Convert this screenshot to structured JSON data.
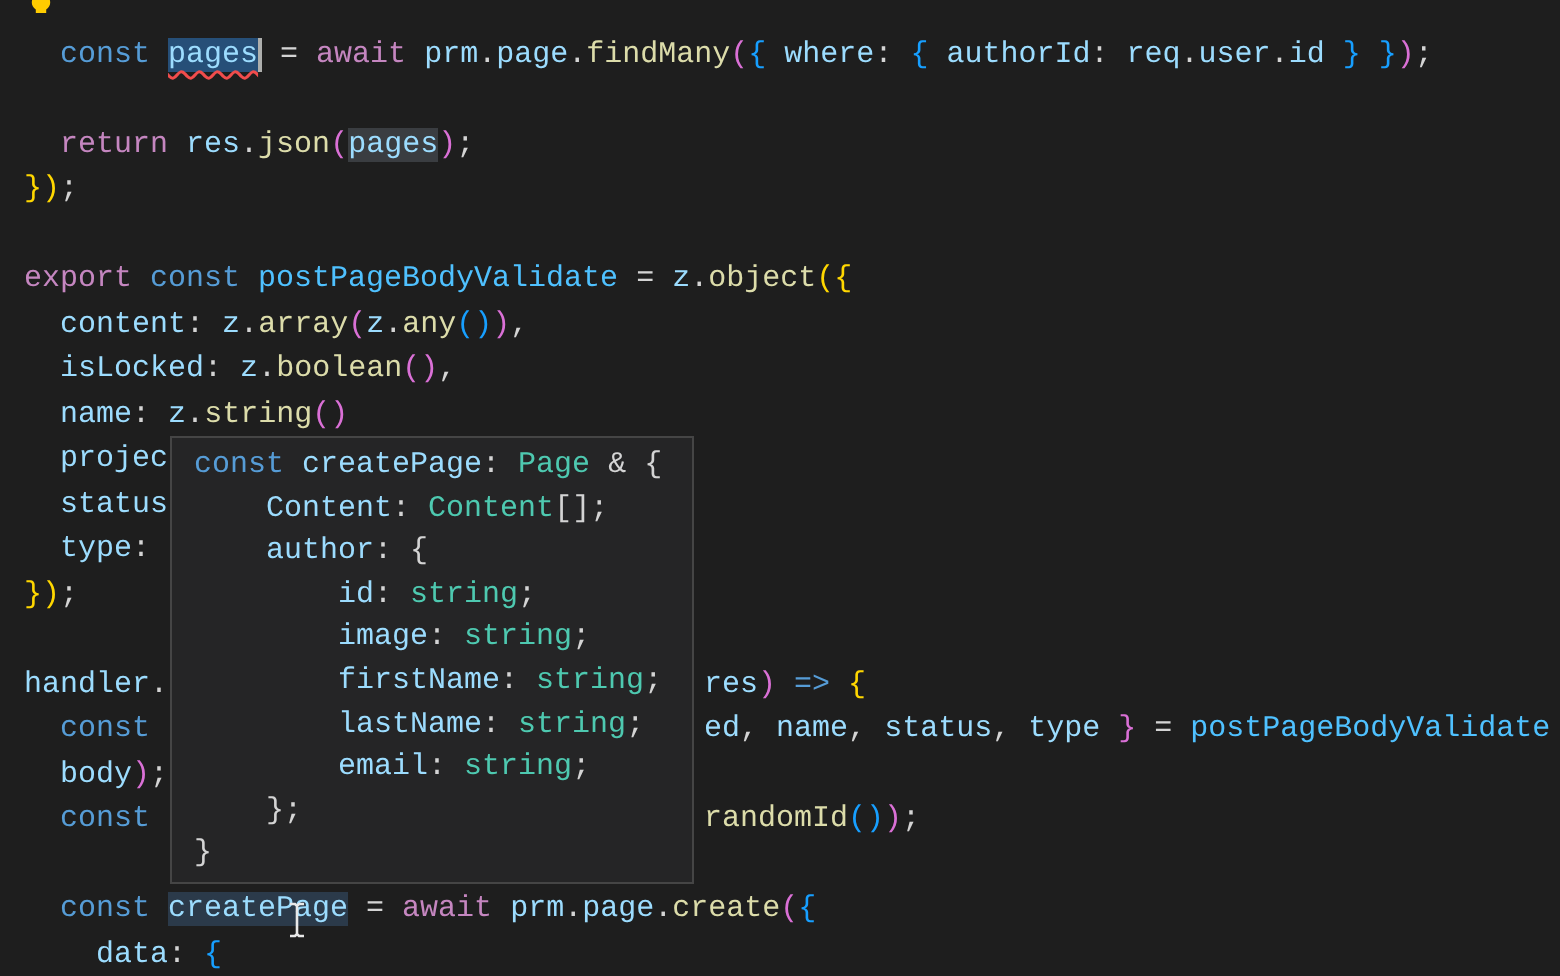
{
  "editor": {
    "lines": [
      {
        "kind": "blank"
      },
      {
        "tokens": [
          {
            "kind": "keyword",
            "t": "  const "
          },
          {
            "kind": "variable",
            "t": "pages",
            "selected": true,
            "error": true
          },
          {
            "kind": "punct",
            "t": " = "
          },
          {
            "kind": "control",
            "t": "await "
          },
          {
            "kind": "variable",
            "t": "prm"
          },
          {
            "kind": "punct",
            "t": "."
          },
          {
            "kind": "variable",
            "t": "page"
          },
          {
            "kind": "punct",
            "t": "."
          },
          {
            "kind": "function",
            "t": "findMany"
          },
          {
            "kind": "bracket2",
            "t": "("
          },
          {
            "kind": "bracket3",
            "t": "{ "
          },
          {
            "kind": "variable",
            "t": "where"
          },
          {
            "kind": "punct",
            "t": ": "
          },
          {
            "kind": "bracket3",
            "t": "{ "
          },
          {
            "kind": "variable",
            "t": "authorId"
          },
          {
            "kind": "punct",
            "t": ": "
          },
          {
            "kind": "variable",
            "t": "req"
          },
          {
            "kind": "punct",
            "t": "."
          },
          {
            "kind": "variable",
            "t": "user"
          },
          {
            "kind": "punct",
            "t": "."
          },
          {
            "kind": "variable",
            "t": "id "
          },
          {
            "kind": "bracket3",
            "t": "} "
          },
          {
            "kind": "bracket3",
            "t": "}"
          },
          {
            "kind": "bracket2",
            "t": ")"
          },
          {
            "kind": "punct",
            "t": ";"
          }
        ]
      },
      {
        "kind": "blank"
      },
      {
        "tokens": [
          {
            "kind": "control",
            "t": "  return "
          },
          {
            "kind": "variable",
            "t": "res"
          },
          {
            "kind": "punct",
            "t": "."
          },
          {
            "kind": "function",
            "t": "json"
          },
          {
            "kind": "bracket2",
            "t": "("
          },
          {
            "kind": "variable",
            "t": "pages",
            "highlighted": true
          },
          {
            "kind": "bracket2",
            "t": ")"
          },
          {
            "kind": "punct",
            "t": ";"
          }
        ]
      },
      {
        "tokens": [
          {
            "kind": "bracket1",
            "t": "})"
          },
          {
            "kind": "punct",
            "t": ";"
          }
        ]
      },
      {
        "kind": "blank"
      },
      {
        "tokens": [
          {
            "kind": "control",
            "t": "export "
          },
          {
            "kind": "keyword",
            "t": "const "
          },
          {
            "kind": "constant",
            "t": "postPageBodyValidate"
          },
          {
            "kind": "punct",
            "t": " = "
          },
          {
            "kind": "variable",
            "t": "z"
          },
          {
            "kind": "punct",
            "t": "."
          },
          {
            "kind": "function",
            "t": "object"
          },
          {
            "kind": "bracket1",
            "t": "({"
          }
        ]
      },
      {
        "tokens": [
          {
            "kind": "variable",
            "t": "  content"
          },
          {
            "kind": "punct",
            "t": ": "
          },
          {
            "kind": "variable",
            "t": "z"
          },
          {
            "kind": "punct",
            "t": "."
          },
          {
            "kind": "function",
            "t": "array"
          },
          {
            "kind": "bracket2",
            "t": "("
          },
          {
            "kind": "variable",
            "t": "z"
          },
          {
            "kind": "punct",
            "t": "."
          },
          {
            "kind": "function",
            "t": "any"
          },
          {
            "kind": "bracket3",
            "t": "()"
          },
          {
            "kind": "bracket2",
            "t": ")"
          },
          {
            "kind": "punct",
            "t": ","
          }
        ]
      },
      {
        "tokens": [
          {
            "kind": "variable",
            "t": "  isLocked"
          },
          {
            "kind": "punct",
            "t": ": "
          },
          {
            "kind": "variable",
            "t": "z"
          },
          {
            "kind": "punct",
            "t": "."
          },
          {
            "kind": "function",
            "t": "boolean"
          },
          {
            "kind": "bracket2",
            "t": "()"
          },
          {
            "kind": "punct",
            "t": ","
          }
        ]
      },
      {
        "tokens": [
          {
            "kind": "variable",
            "t": "  name"
          },
          {
            "kind": "punct",
            "t": ": "
          },
          {
            "kind": "variable",
            "t": "z"
          },
          {
            "kind": "punct",
            "t": "."
          },
          {
            "kind": "function",
            "t": "string"
          },
          {
            "kind": "bracket2",
            "t": "()"
          }
        ]
      },
      {
        "tokens": [
          {
            "kind": "variable",
            "t": "  projec"
          }
        ]
      },
      {
        "tokens": [
          {
            "kind": "variable",
            "t": "  status"
          }
        ]
      },
      {
        "tokens": [
          {
            "kind": "variable",
            "t": "  type"
          },
          {
            "kind": "punct",
            "t": ":"
          }
        ]
      },
      {
        "tokens": [
          {
            "kind": "bracket1",
            "t": "})"
          },
          {
            "kind": "punct",
            "t": ";"
          }
        ]
      },
      {
        "kind": "blank"
      },
      {
        "tokens": [
          {
            "kind": "variable",
            "t": "handler"
          },
          {
            "kind": "punct",
            "t": "."
          }
        ],
        "right": [
          {
            "kind": "variable",
            "t": "res"
          },
          {
            "kind": "bracket2",
            "t": ")"
          },
          {
            "kind": "keyword",
            "t": " => "
          },
          {
            "kind": "bracket1",
            "t": "{"
          }
        ]
      },
      {
        "tokens": [
          {
            "kind": "keyword",
            "t": "  const"
          }
        ],
        "right": [
          {
            "kind": "variable",
            "t": "ed"
          },
          {
            "kind": "punct",
            "t": ", "
          },
          {
            "kind": "variable",
            "t": "name"
          },
          {
            "kind": "punct",
            "t": ", "
          },
          {
            "kind": "variable",
            "t": "status"
          },
          {
            "kind": "punct",
            "t": ", "
          },
          {
            "kind": "variable",
            "t": "type "
          },
          {
            "kind": "bracket2",
            "t": "}"
          },
          {
            "kind": "punct",
            "t": " = "
          },
          {
            "kind": "constant",
            "t": "postPageBodyValidate"
          }
        ]
      },
      {
        "tokens": [
          {
            "kind": "variable",
            "t": "  body"
          },
          {
            "kind": "bracket2",
            "t": ")"
          },
          {
            "kind": "punct",
            "t": ";"
          }
        ]
      },
      {
        "tokens": [
          {
            "kind": "keyword",
            "t": "  const"
          }
        ],
        "right": [
          {
            "kind": "function",
            "t": "randomId"
          },
          {
            "kind": "bracket3",
            "t": "()"
          },
          {
            "kind": "bracket2",
            "t": ")"
          },
          {
            "kind": "punct",
            "t": ";"
          }
        ]
      },
      {
        "kind": "blank"
      },
      {
        "tokens": [
          {
            "kind": "keyword",
            "t": "  const "
          },
          {
            "kind": "variable",
            "t": "createPage",
            "hovered": true
          },
          {
            "kind": "punct",
            "t": " = "
          },
          {
            "kind": "control",
            "t": "await "
          },
          {
            "kind": "variable",
            "t": "prm"
          },
          {
            "kind": "punct",
            "t": "."
          },
          {
            "kind": "variable",
            "t": "page"
          },
          {
            "kind": "punct",
            "t": "."
          },
          {
            "kind": "function",
            "t": "create"
          },
          {
            "kind": "bracket2",
            "t": "("
          },
          {
            "kind": "bracket3",
            "t": "{"
          }
        ]
      },
      {
        "tokens": [
          {
            "kind": "variable",
            "t": "    data"
          },
          {
            "kind": "punct",
            "t": ": "
          },
          {
            "kind": "bracket3",
            "t": "{"
          }
        ]
      }
    ]
  },
  "hover": {
    "lines": [
      {
        "tokens": [
          {
            "kind": "keyword",
            "t": "const "
          },
          {
            "kind": "variable",
            "t": "createPage"
          },
          {
            "kind": "punct",
            "t": ": "
          },
          {
            "kind": "type",
            "t": "Page"
          },
          {
            "kind": "punct",
            "t": " & {"
          }
        ]
      },
      {
        "tokens": [
          {
            "kind": "variable",
            "t": "    Content"
          },
          {
            "kind": "punct",
            "t": ": "
          },
          {
            "kind": "type",
            "t": "Content"
          },
          {
            "kind": "punct",
            "t": "[];"
          }
        ]
      },
      {
        "tokens": [
          {
            "kind": "variable",
            "t": "    author"
          },
          {
            "kind": "punct",
            "t": ": {"
          }
        ]
      },
      {
        "tokens": [
          {
            "kind": "variable",
            "t": "        id"
          },
          {
            "kind": "punct",
            "t": ": "
          },
          {
            "kind": "type",
            "t": "string"
          },
          {
            "kind": "punct",
            "t": ";"
          }
        ]
      },
      {
        "tokens": [
          {
            "kind": "variable",
            "t": "        image"
          },
          {
            "kind": "punct",
            "t": ": "
          },
          {
            "kind": "type",
            "t": "string"
          },
          {
            "kind": "punct",
            "t": ";"
          }
        ]
      },
      {
        "tokens": [
          {
            "kind": "variable",
            "t": "        firstName"
          },
          {
            "kind": "punct",
            "t": ": "
          },
          {
            "kind": "type",
            "t": "string"
          },
          {
            "kind": "punct",
            "t": ";"
          }
        ]
      },
      {
        "tokens": [
          {
            "kind": "variable",
            "t": "        lastName"
          },
          {
            "kind": "punct",
            "t": ": "
          },
          {
            "kind": "type",
            "t": "string"
          },
          {
            "kind": "punct",
            "t": ";"
          }
        ]
      },
      {
        "tokens": [
          {
            "kind": "variable",
            "t": "        email"
          },
          {
            "kind": "punct",
            "t": ": "
          },
          {
            "kind": "type",
            "t": "string"
          },
          {
            "kind": "punct",
            "t": ";"
          }
        ]
      },
      {
        "tokens": [
          {
            "kind": "punct",
            "t": "    };"
          }
        ]
      },
      {
        "tokens": [
          {
            "kind": "punct",
            "t": "}"
          }
        ]
      }
    ]
  }
}
